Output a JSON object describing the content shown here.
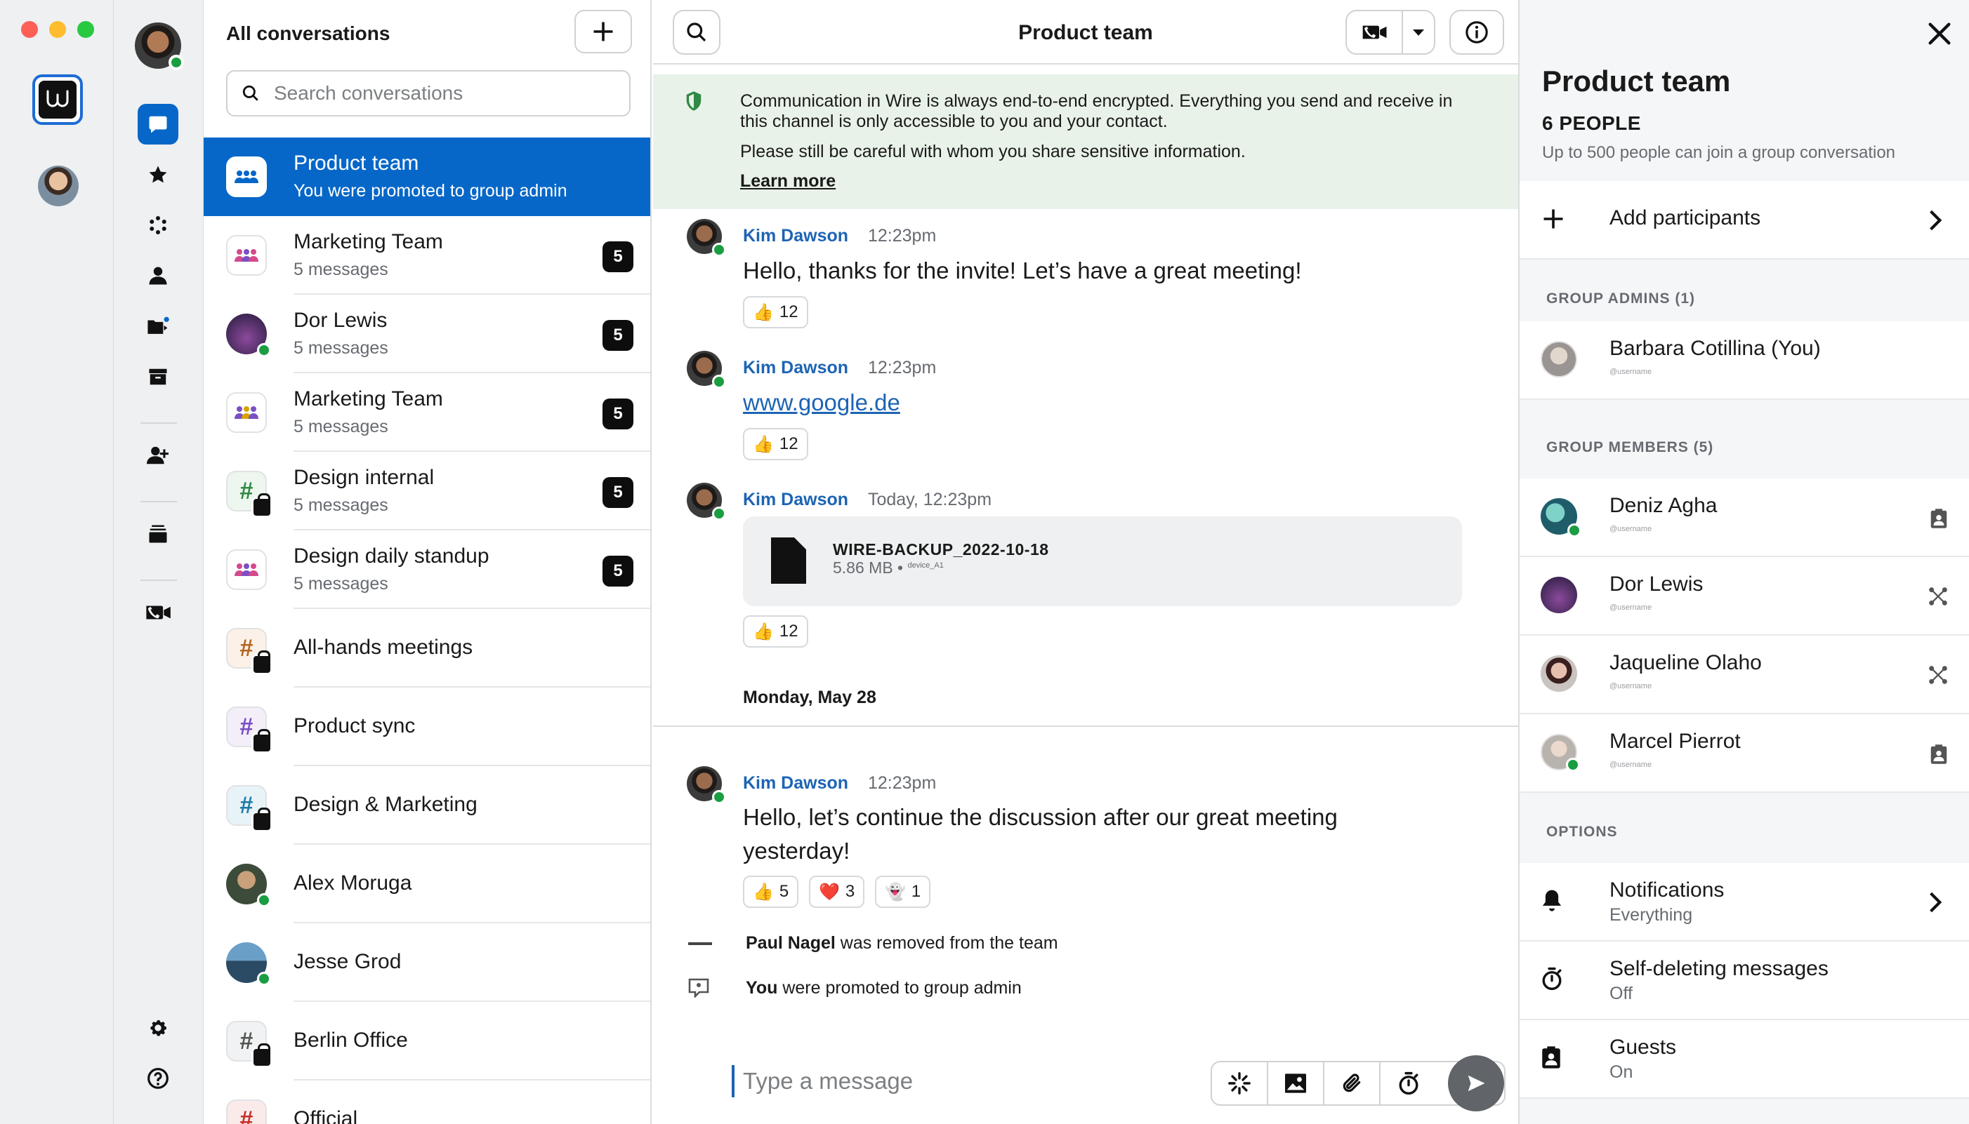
{
  "accounts": {
    "team_logo_letter": "W"
  },
  "list": {
    "title": "All conversations",
    "search_placeholder": "Search conversations",
    "conversations": [
      {
        "name": "Product team",
        "subtitle": "You were promoted to group admin",
        "badge": ""
      },
      {
        "name": "Marketing Team",
        "subtitle": "5 messages",
        "badge": "5"
      },
      {
        "name": "Dor Lewis",
        "subtitle": "5 messages",
        "badge": "5"
      },
      {
        "name": "Marketing Team",
        "subtitle": "5 messages",
        "badge": "5"
      },
      {
        "name": "Design internal",
        "subtitle": "5 messages",
        "badge": "5"
      },
      {
        "name": "Design daily standup",
        "subtitle": "5 messages",
        "badge": "5"
      },
      {
        "name": "All-hands meetings",
        "subtitle": "",
        "badge": ""
      },
      {
        "name": "Product sync",
        "subtitle": "",
        "badge": ""
      },
      {
        "name": "Design & Marketing",
        "subtitle": "",
        "badge": ""
      },
      {
        "name": "Alex Moruga",
        "subtitle": "",
        "badge": ""
      },
      {
        "name": "Jesse Grod",
        "subtitle": "",
        "badge": ""
      },
      {
        "name": "Berlin Office",
        "subtitle": "",
        "badge": ""
      },
      {
        "name": "Official",
        "subtitle": "",
        "badge": ""
      }
    ]
  },
  "chat": {
    "title": "Product team",
    "e2ee": {
      "line1": "Communication in Wire is always end-to-end encrypted. Everything you send and receive in this channel is only accessible to you and your contact.",
      "line2": "Please still be careful with whom you share sensitive information.",
      "learn_more": "Learn more"
    },
    "messages": [
      {
        "sender": "Kim Dawson",
        "time": "12:23pm",
        "text": "Hello, thanks for the invite! Let’s have a great meeting!",
        "reaction": "12"
      },
      {
        "sender": "Kim Dawson",
        "time": "12:23pm",
        "link": "www.google.de",
        "reaction": "12"
      },
      {
        "sender": "Kim Dawson",
        "time": "Today, 12:23pm",
        "file_name": "WIRE-BACKUP_2022-10-18",
        "file_size": "5.86 MB",
        "file_device": "device_A1",
        "reaction": "12"
      }
    ],
    "date_divider": "Monday, May 28",
    "last_message": {
      "sender": "Kim Dawson",
      "time": "12:23pm",
      "text_line1": "Hello, let’s continue the discussion after our great meeting",
      "text_line2": "yesterday!",
      "reactions": [
        {
          "emoji": "👍",
          "count": "5"
        },
        {
          "emoji": "❤️",
          "count": "3"
        },
        {
          "emoji": "👻",
          "count": "1"
        }
      ]
    },
    "system": [
      {
        "actor": "Paul Nagel",
        "text": " was removed from the team"
      },
      {
        "actor": "You",
        "text": " were promoted to group admin"
      }
    ],
    "composer_placeholder": "Type a message"
  },
  "details": {
    "title": "Product team",
    "people_count": "6 PEOPLE",
    "capacity_note": "Up to 500 people can join a group conversation",
    "add_participants": "Add participants",
    "admins_header": "GROUP ADMINS (1)",
    "admins": [
      {
        "name": "Barbara Cotillina (You)",
        "username": "@username"
      }
    ],
    "members_header": "GROUP MEMBERS (5)",
    "members": [
      {
        "name": "Deniz Agha",
        "username": "@username"
      },
      {
        "name": "Dor Lewis",
        "username": "@username"
      },
      {
        "name": "Jaqueline Olaho",
        "username": "@username"
      },
      {
        "name": "Marcel Pierrot",
        "username": "@username"
      }
    ],
    "options_header": "OPTIONS",
    "options": [
      {
        "label": "Notifications",
        "value": "Everything"
      },
      {
        "label": "Self-deleting messages",
        "value": "Off"
      },
      {
        "label": "Guests",
        "value": "On"
      }
    ]
  },
  "colors": {
    "accent": "#0667c8",
    "sender": "#1d64b4",
    "online": "#1b9d42",
    "e2ee_bg": "#e9f2e9"
  }
}
